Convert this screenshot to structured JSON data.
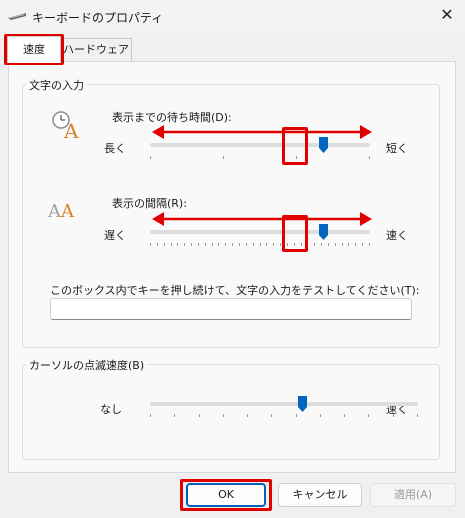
{
  "window": {
    "title": "キーボードのプロパティ",
    "close_glyph": "✕"
  },
  "tabs": [
    {
      "label": "速度",
      "selected": true
    },
    {
      "label": "ハードウェア",
      "selected": false
    }
  ],
  "char_input": {
    "group_label": "文字の入力",
    "repeat_delay": {
      "label": "表示までの待ち時間(D):",
      "left": "長く",
      "right": "短く",
      "value_fraction": 0.79
    },
    "repeat_rate": {
      "label": "表示の間隔(R):",
      "left": "遅く",
      "right": "速く",
      "value_fraction": 0.79
    },
    "test_label": "このボックス内でキーを押し続けて、文字の入力をテストしてください(T):",
    "test_value": ""
  },
  "cursor": {
    "group_label": "カーソルの点滅速度(B)",
    "left": "なし",
    "right": "速く",
    "value_fraction": 0.57
  },
  "buttons": {
    "ok": "OK",
    "cancel": "キャンセル",
    "apply": "適用(A)"
  },
  "colors": {
    "accent": "#0067c0",
    "highlight": "#e00000"
  },
  "icons": {
    "delay": "clock-letter-a-icon",
    "rate": "double-letter-a-icon"
  }
}
